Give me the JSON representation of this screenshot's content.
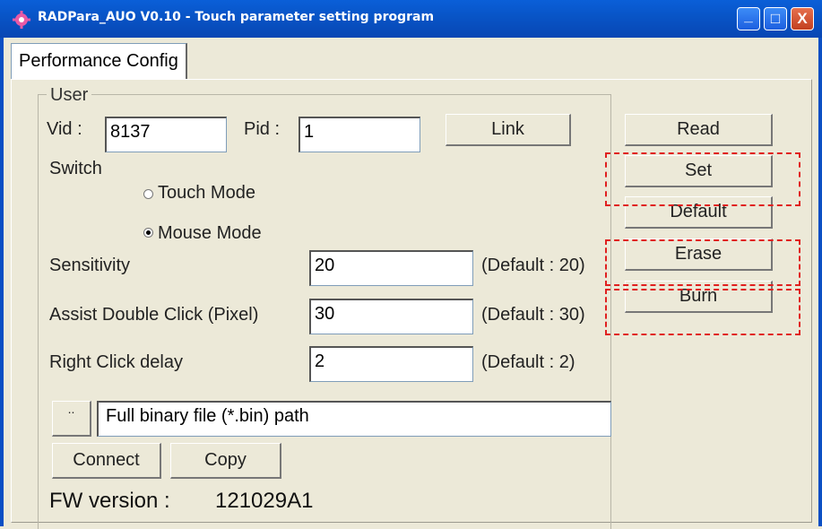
{
  "window": {
    "title": "RADPara_AUO V0.10 - Touch parameter setting program",
    "icon": "gear-app-icon",
    "controls": {
      "minimize": "_",
      "maximize": "□",
      "close": "X"
    }
  },
  "tabs": [
    {
      "label": "Performance Config",
      "active": true
    }
  ],
  "user_group": {
    "legend": "User",
    "vid_label": "Vid :",
    "vid_value": "8137",
    "pid_label": "Pid :",
    "pid_value": "1",
    "link_button": "Link"
  },
  "switch": {
    "label": "Switch",
    "options": [
      {
        "label": "Touch Mode",
        "checked": false
      },
      {
        "label": "Mouse Mode",
        "checked": true
      }
    ]
  },
  "params": [
    {
      "label": "Sensitivity",
      "value": "20",
      "default": "(Default : 20)"
    },
    {
      "label": "Assist Double Click (Pixel)",
      "value": "30",
      "default": "(Default : 30)"
    },
    {
      "label": "Right Click delay",
      "value": "2",
      "default": "(Default : 2)"
    }
  ],
  "side_buttons": {
    "read": "Read",
    "set": "Set",
    "default": "Default",
    "erase": "Erase",
    "burn": "Burn"
  },
  "file": {
    "browse_button": "..",
    "path_value": "Full binary file (*.bin) path"
  },
  "bottom_buttons": {
    "connect": "Connect",
    "copy": "Copy"
  },
  "fw": {
    "label": "FW version :",
    "value": "121029A1"
  },
  "colors": {
    "highlight_dash": "#e02020",
    "titlebar": "#0a5fd8"
  }
}
